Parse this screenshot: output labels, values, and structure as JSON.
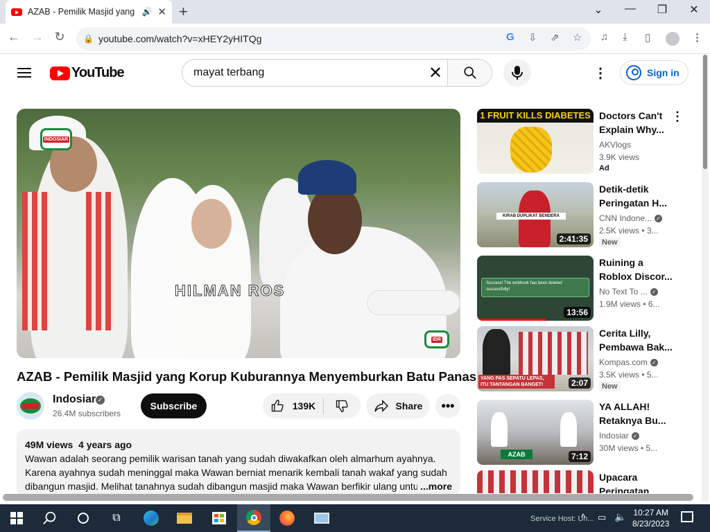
{
  "browser": {
    "tab_title": "AZAB - Pemilik Masjid yang Korup Kuburannya Menyemburkan Batu Panas",
    "url": "youtube.com/watch?v=xHEY2yHITQg"
  },
  "yt_header": {
    "logo_text": "YouTube",
    "search_value": "mayat terbang",
    "signin_label": "Sign in"
  },
  "video": {
    "title": "AZAB - Pemilik Masjid yang Korup Kuburannya Menyemburkan Batu Panas",
    "watermark": "HILMAN ROS",
    "channel_name": "Indosiar",
    "subscribers": "26.4M subscribers",
    "subscribe_label": "Subscribe",
    "likes": "139K",
    "share_label": "Share",
    "views": "49M views",
    "age": "4 years ago",
    "description": "Wawan adalah seorang pemilik warisan tanah yang sudah diwakafkan oleh almarhum ayahnya. Karena ayahnya sudah meninggal maka Wawan berniat menarik kembali tanah wakaf yang sudah dibangun masjid. Melihat tanahnya sudah dibangun masjid maka Wawan berfikir ulang untu",
    "more_label": "...more"
  },
  "recommendations": [
    {
      "title": "Doctors Can't Explain Why...",
      "channel": "AKVlogs",
      "views": "3.9K views",
      "badge": "Ad",
      "duration": "",
      "thumb_text": "1 FRUIT KILLS DIABETES"
    },
    {
      "title": "Detik-detik Peringatan H...",
      "channel": "CNN Indone...",
      "views": "2.5K views • 3...",
      "badge": "New",
      "duration": "2:41:35",
      "thumb_text": "KIRAB DUPLIKAT BENDERA PUSAKA"
    },
    {
      "title": "Ruining a Roblox Discor...",
      "channel": "No Text To ...",
      "views": "1.9M views • 6...",
      "badge": "",
      "duration": "13:56",
      "thumb_text": "Success! The webhook has been deleted successfully!"
    },
    {
      "title": "Cerita Lilly, Pembawa Bak...",
      "channel": "Kompas.com",
      "views": "3.5K views • 5...",
      "badge": "New",
      "duration": "2:07",
      "thumb_text": "YANG PAS SEPATU LEPAS, ITU TANTANGAN BANGET!"
    },
    {
      "title": "YA ALLAH! Retaknya Bu...",
      "channel": "Indosiar",
      "views": "30M views • 5...",
      "badge": "",
      "duration": "7:12",
      "thumb_text": "AZAB"
    },
    {
      "title": "Upacara Peringatan",
      "channel": "",
      "views": "",
      "badge": "",
      "duration": "",
      "thumb_text": ""
    }
  ],
  "taskbar": {
    "tray_text": "Service Host: Un...",
    "time": "10:27 AM",
    "date": "8/23/2023"
  }
}
